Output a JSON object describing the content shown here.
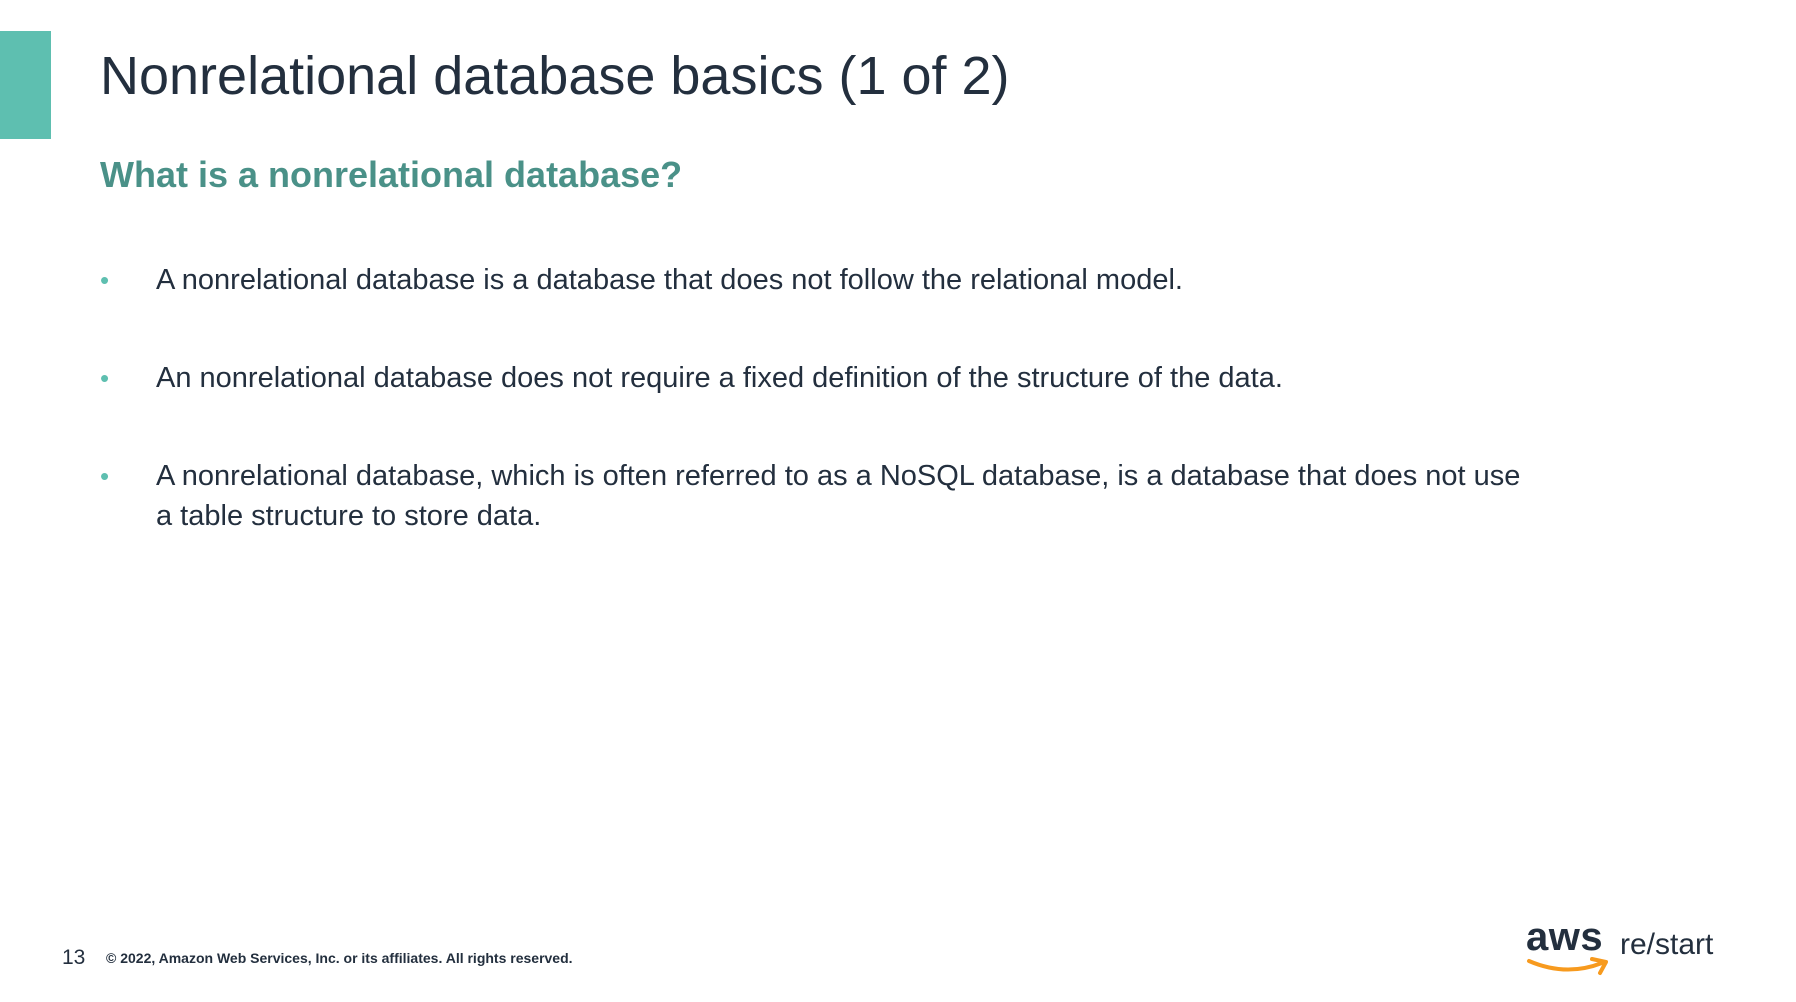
{
  "slide": {
    "title": "Nonrelational database basics (1 of 2)",
    "subtitle": "What is a nonrelational database?",
    "bullets": [
      "A nonrelational database is a database that does not follow the relational model.",
      "An nonrelational database does not require a fixed definition of the structure of the data.",
      "A nonrelational database, which is often referred to as a NoSQL database, is a database that does not use a table structure to store data."
    ],
    "bullet_symbol": "•"
  },
  "footer": {
    "page_number": "13",
    "copyright": "© 2022, Amazon Web Services, Inc. or its affiliates. All rights reserved."
  },
  "logo": {
    "aws": "aws",
    "restart": "re/start"
  },
  "colors": {
    "accent": "#5ebfb0",
    "subtitle": "#4a9188",
    "text": "#232f3e",
    "smile": "#f79a1e"
  }
}
